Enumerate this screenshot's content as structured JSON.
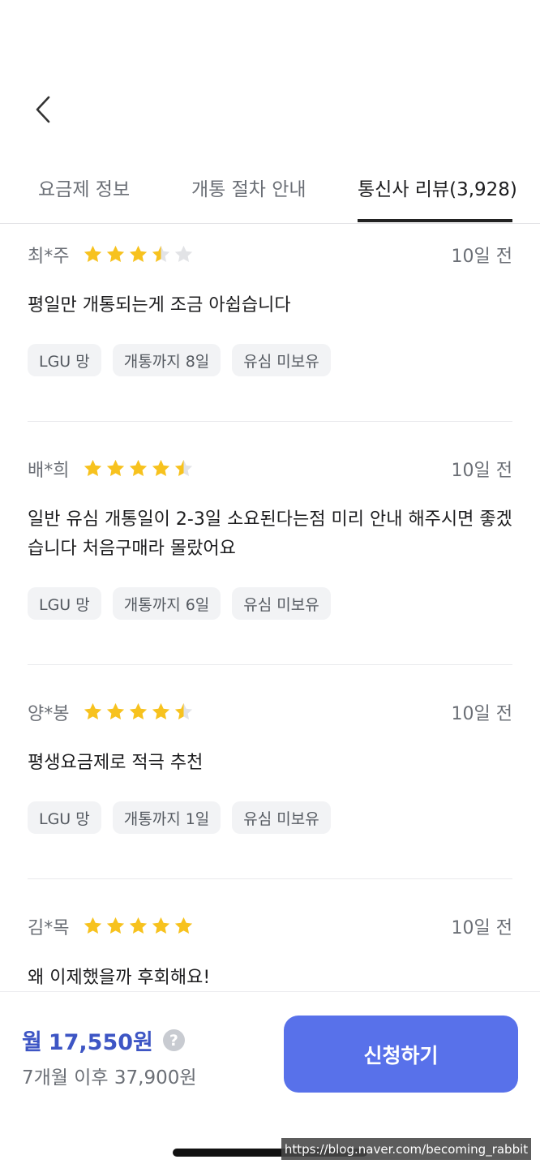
{
  "header": {
    "back_icon": "chevron-left-icon"
  },
  "tabs": [
    {
      "label": "요금제 정보",
      "active": false
    },
    {
      "label": "개통 절차 안내",
      "active": false
    },
    {
      "label": "통신사 리뷰(3,928)",
      "active": true
    }
  ],
  "colors": {
    "accent": "#5871ea",
    "price": "#3d55c4",
    "star": "#f7c21e",
    "star_empty": "#e2e3e6"
  },
  "reviews": [
    {
      "name": "최*주",
      "rating": 3.5,
      "date": "10일 전",
      "text": "평일만 개통되는게 조금 아쉽습니다",
      "tags": [
        "LGU 망",
        "개통까지 8일",
        "유심 미보유"
      ]
    },
    {
      "name": "배*희",
      "rating": 4.5,
      "date": "10일 전",
      "text": "일반 유심 개통일이 2-3일 소요된다는점 미리 안내 해주시면 좋겠습니다 처음구매라 몰랐어요",
      "tags": [
        "LGU 망",
        "개통까지 6일",
        "유심 미보유"
      ]
    },
    {
      "name": "양*봉",
      "rating": 4.5,
      "date": "10일 전",
      "text": "평생요금제로 적극 추천",
      "tags": [
        "LGU 망",
        "개통까지 1일",
        "유심 미보유"
      ]
    },
    {
      "name": "김*목",
      "rating": 5,
      "date": "10일 전",
      "text": "왜 이제했을까 후회해요!",
      "tags": []
    }
  ],
  "bottom": {
    "price_prefix": "월",
    "price": "17,550원",
    "help_icon": "question-circle-icon",
    "after_price": "7개월 이후 37,900원",
    "apply_label": "신청하기"
  },
  "watermark": "https://blog.naver.com/becoming_rabbit"
}
